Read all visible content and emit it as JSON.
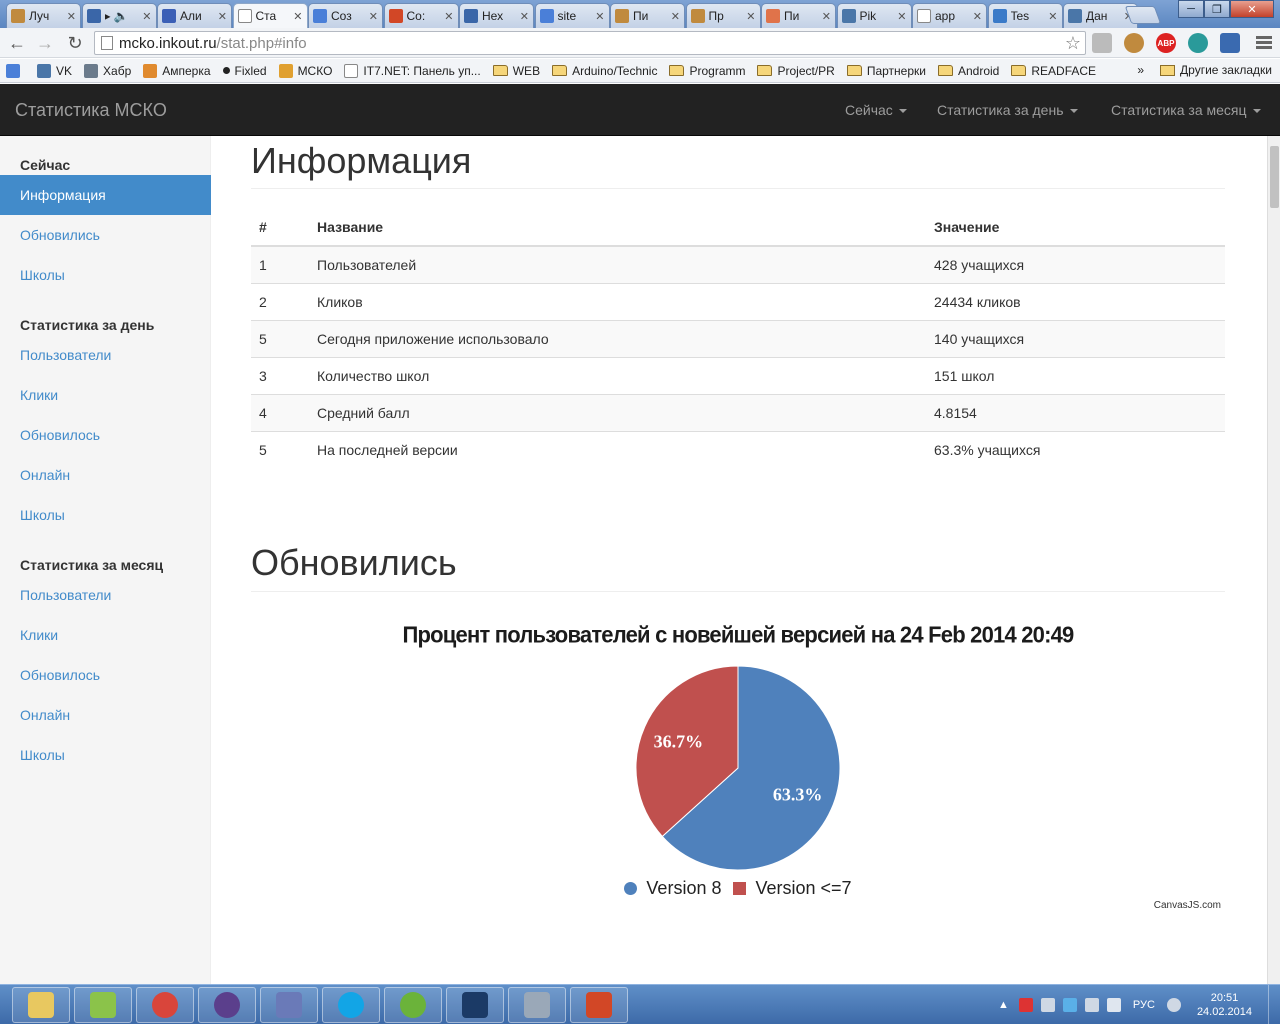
{
  "browser": {
    "tabs": [
      {
        "title": "Луч",
        "icon": "hedgehog-icon",
        "color": "#c08a3e"
      },
      {
        "title": "▸ 🔈",
        "icon": "play-icon",
        "color": "#3a66a8"
      },
      {
        "title": "Али",
        "icon": "aliexpress-icon",
        "color": "#3b5fb6"
      },
      {
        "title": "Ста",
        "icon": "page-icon",
        "color": "#ffffff"
      },
      {
        "title": "Соз",
        "icon": "google-icon",
        "color": "#4a7fd8"
      },
      {
        "title": "Со:",
        "icon": "office-icon",
        "color": "#d24726"
      },
      {
        "title": "Нех",
        "icon": "js-icon",
        "color": "#3a66a8"
      },
      {
        "title": "site",
        "icon": "google-icon",
        "color": "#4a7fd8"
      },
      {
        "title": "Пи",
        "icon": "hedgehog-icon",
        "color": "#c08a3e"
      },
      {
        "title": "Пр",
        "icon": "hedgehog-icon",
        "color": "#c08a3e"
      },
      {
        "title": "Пи",
        "icon": "calendar-icon",
        "color": "#e0734a"
      },
      {
        "title": "Pik",
        "icon": "vk-icon",
        "color": "#4a76a8"
      },
      {
        "title": "app",
        "icon": "page-icon",
        "color": "#ffffff"
      },
      {
        "title": "Tes",
        "icon": "gear-icon",
        "color": "#3a7ac8"
      },
      {
        "title": "Дан",
        "icon": "vk-icon",
        "color": "#4a76a8"
      }
    ],
    "url_host": "mcko.inkout.ru",
    "url_path": "/stat.php#info",
    "bookmarks": [
      {
        "label": "",
        "icon": "google-icon",
        "color": "#4a7fd8",
        "type": "site"
      },
      {
        "label": "VK",
        "icon": "vk-icon",
        "color": "#4a76a8",
        "type": "site"
      },
      {
        "label": "Хабр",
        "icon": "habr-icon",
        "color": "#6b7b8c",
        "type": "site"
      },
      {
        "label": "Амперка",
        "icon": "amperka-icon",
        "color": "#e08a2e",
        "type": "site"
      },
      {
        "label": "Fixled",
        "icon": "dot-icon",
        "color": "#222222",
        "type": "site"
      },
      {
        "label": "МСКО",
        "icon": "sun-icon",
        "color": "#e0a030",
        "type": "site"
      },
      {
        "label": "IT7.NET: Панель уп...",
        "icon": "page-icon",
        "color": "#ffffff",
        "type": "site"
      },
      {
        "label": "WEB",
        "type": "folder"
      },
      {
        "label": "Arduino/Technic",
        "type": "folder"
      },
      {
        "label": "Programm",
        "type": "folder"
      },
      {
        "label": "Project/PR",
        "type": "folder"
      },
      {
        "label": "Партнерки",
        "type": "folder"
      },
      {
        "label": "Android",
        "type": "folder"
      },
      {
        "label": "READFACE",
        "type": "folder"
      }
    ],
    "more": "»",
    "other_bookmarks": "Другие закладки"
  },
  "navbar": {
    "brand": "Статистика МСКО",
    "items": [
      "Сейчас",
      "Статистика за день",
      "Статистика за месяц"
    ]
  },
  "sidebar": {
    "sections": [
      {
        "heading": "Сейчас",
        "links": [
          "Информация",
          "Обновились",
          "Школы"
        ]
      },
      {
        "heading": "Статистика за день",
        "links": [
          "Пользователи",
          "Клики",
          "Обновилось",
          "Онлайн",
          "Школы"
        ]
      },
      {
        "heading": "Статистика за месяц",
        "links": [
          "Пользователи",
          "Клики",
          "Обновилось",
          "Онлайн",
          "Школы"
        ]
      }
    ],
    "active": "Информация"
  },
  "info": {
    "title": "Информация",
    "headers": [
      "#",
      "Название",
      "Значение"
    ],
    "rows": [
      [
        "1",
        "Пользователей",
        "428 учащихся"
      ],
      [
        "2",
        "Кликов",
        "24434 кликов"
      ],
      [
        "5",
        "Сегодня приложение использовало",
        "140 учащихся"
      ],
      [
        "3",
        "Количество школ",
        "151 школ"
      ],
      [
        "4",
        "Средний балл",
        "4.8154"
      ],
      [
        "5",
        "На последней версии",
        "63.3% учащихся"
      ]
    ]
  },
  "updated": {
    "title": "Обновились"
  },
  "chart_data": {
    "type": "pie",
    "title": "Процент пользователей с новейшей версией на 24 Feb 2014 20:49",
    "slices": [
      {
        "name": "Version 8",
        "value": 63.3,
        "label": "63.3%",
        "color": "#4f81bc"
      },
      {
        "name": "Version <=7",
        "value": 36.7,
        "label": "36.7%",
        "color": "#c0504e"
      }
    ],
    "legend_position": "bottom",
    "credit": "CanvasJS.com"
  },
  "taskbar": {
    "apps": [
      {
        "name": "explorer",
        "icon": "folder-icon",
        "color": "#e8c860"
      },
      {
        "name": "notepad++",
        "icon": "notepad-icon",
        "color": "#8bc34a"
      },
      {
        "name": "chrome",
        "icon": "chrome-icon",
        "color": "#d9453b"
      },
      {
        "name": "eclipse",
        "icon": "eclipse-icon",
        "color": "#5b3f8c"
      },
      {
        "name": "php",
        "icon": "php-icon",
        "color": "#6a7ab8"
      },
      {
        "name": "skype",
        "icon": "skype-icon",
        "color": "#12a5e6"
      },
      {
        "name": "brackets",
        "icon": "brackets-icon",
        "color": "#6bb33a"
      },
      {
        "name": "photoshop",
        "icon": "photoshop-icon",
        "color": "#1b3a66"
      },
      {
        "name": "calculator",
        "icon": "calculator-icon",
        "color": "#9aa8b8"
      },
      {
        "name": "powerpoint",
        "icon": "powerpoint-icon",
        "color": "#d24726"
      }
    ],
    "language": "РУС",
    "time": "20:51",
    "date": "24.02.2014"
  }
}
